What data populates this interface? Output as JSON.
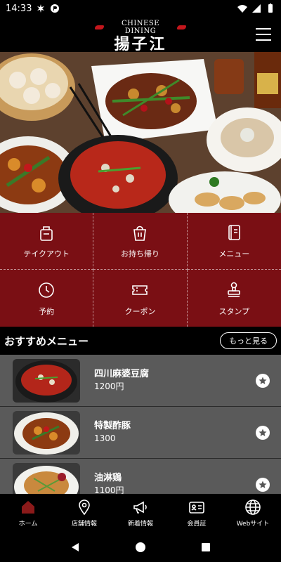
{
  "status_bar": {
    "time": "14:33",
    "icons": [
      "notification-icon",
      "data-saver-icon",
      "wifi-icon",
      "signal-icon",
      "battery-icon"
    ]
  },
  "header": {
    "brand_sub": "CHINESE DINING",
    "brand_main": "揚子江",
    "menu_icon": "hamburger-icon"
  },
  "hero": {
    "image": "chinese-food-spread-photo"
  },
  "grid": {
    "items": [
      {
        "label": "テイクアウト",
        "icon": "takeout-bag-icon"
      },
      {
        "label": "お持ち帰り",
        "icon": "food-box-icon"
      },
      {
        "label": "メニュー",
        "icon": "menu-book-icon"
      },
      {
        "label": "予約",
        "icon": "clock-icon"
      },
      {
        "label": "クーポン",
        "icon": "coupon-icon"
      },
      {
        "label": "スタンプ",
        "icon": "stamp-icon"
      }
    ]
  },
  "recommend": {
    "title": "おすすめメニュー",
    "more_label": "もっと見る",
    "items": [
      {
        "name": "四川麻婆豆腐",
        "price": "1200円"
      },
      {
        "name": "特製酢豚",
        "price": "1300"
      },
      {
        "name": "油淋鶏",
        "price": "1100円"
      }
    ]
  },
  "bottom_nav": {
    "items": [
      {
        "label": "ホーム",
        "icon": "home-icon"
      },
      {
        "label": "店舗情報",
        "icon": "location-pin-icon"
      },
      {
        "label": "新着情報",
        "icon": "megaphone-icon"
      },
      {
        "label": "会員証",
        "icon": "member-card-icon"
      },
      {
        "label": "Webサイト",
        "icon": "globe-icon"
      }
    ]
  },
  "colors": {
    "accent": "#7a0f14",
    "brand_red": "#c4161c",
    "active_nav": "#8b1a1a"
  }
}
